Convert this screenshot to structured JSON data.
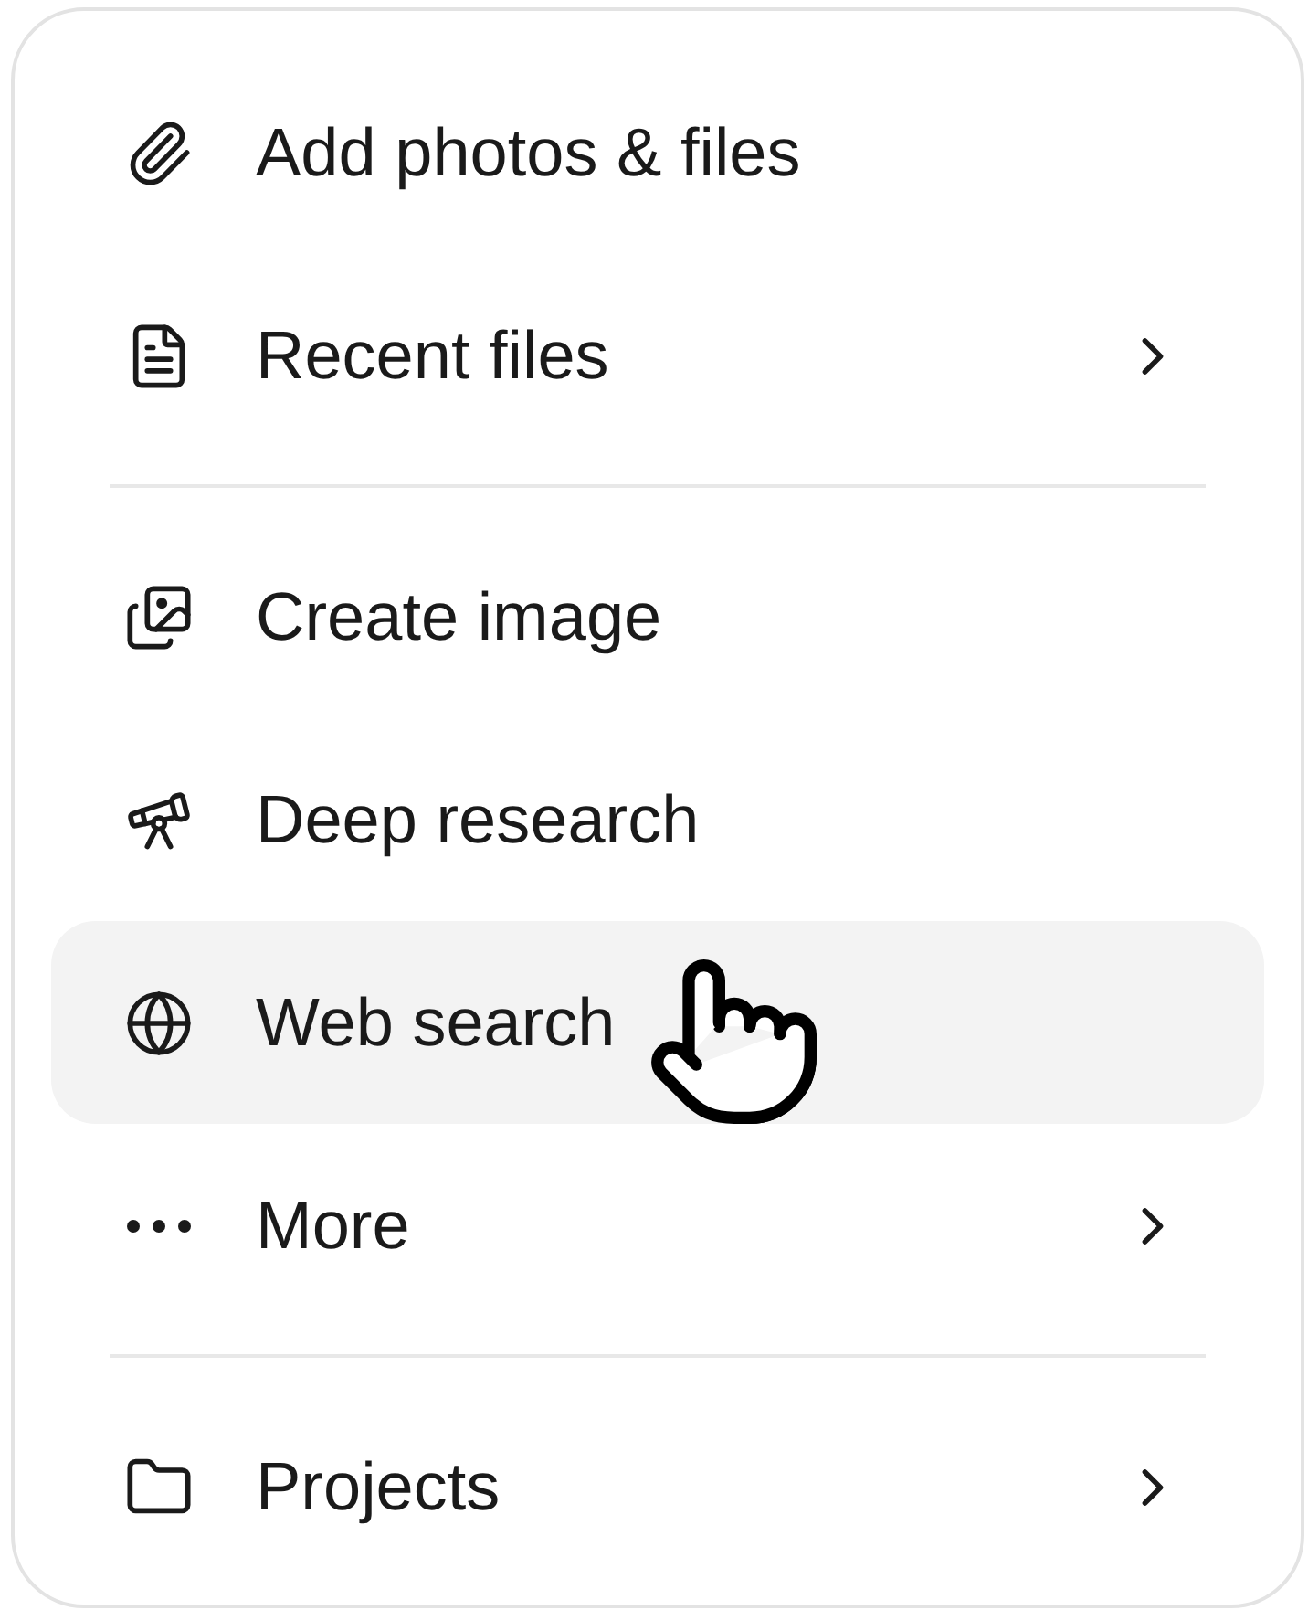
{
  "menu": {
    "groups": [
      [
        {
          "label": "Add photos & files",
          "submenu": false,
          "selected": false
        },
        {
          "label": "Recent files",
          "submenu": true,
          "selected": false
        }
      ],
      [
        {
          "label": "Create image",
          "submenu": false,
          "selected": false
        },
        {
          "label": "Deep research",
          "submenu": false,
          "selected": false
        },
        {
          "label": "Web search",
          "submenu": false,
          "selected": true
        },
        {
          "label": "More",
          "submenu": true,
          "selected": false
        }
      ],
      [
        {
          "label": "Projects",
          "submenu": true,
          "selected": false
        }
      ]
    ]
  }
}
